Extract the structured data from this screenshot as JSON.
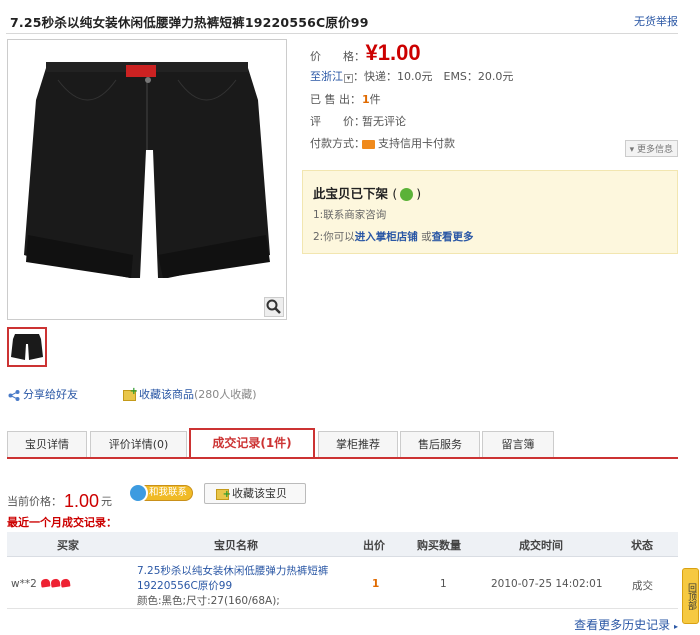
{
  "title": "7.25秒杀以纯女装休闲低腰弹力热裤短裤19220556C原价99",
  "report_link": "无货举报",
  "info": {
    "price_label": "价　　格：",
    "price": "¥1.00",
    "shipping_to": "至浙江",
    "shipping_fees": "：快递：10.0元　EMS：20.0元",
    "sold_label": "已 售 出：",
    "sold_count": "1",
    "sold_unit": "件",
    "rating_label": "评　　价：",
    "rating_value": "暂无评论",
    "payment_label": "付款方式：",
    "payment_value": "支持信用卡付款",
    "more_info": "更多信息"
  },
  "off_shelf": {
    "heading": "此宝贝已下架",
    "line1": "1:联系商家咨询",
    "line2_prefix": "2:你可以",
    "line2_link1": "进入掌柜店铺",
    "line2_mid": "或",
    "line2_link2": "查看更多"
  },
  "share_label": "分享给好友",
  "favorite": {
    "label": "收藏该商品",
    "count": "(280人收藏)"
  },
  "tabs": [
    {
      "label": "宝贝详情"
    },
    {
      "label": "评价详情(0)"
    },
    {
      "label": "成交记录(1件)"
    },
    {
      "label": "掌柜推荐"
    },
    {
      "label": "售后服务"
    },
    {
      "label": "留言簿"
    }
  ],
  "current_price": {
    "label": "当前价格：",
    "value": "1.00",
    "unit": "元"
  },
  "contact_button": "和我联系",
  "favorite_item_button": "收藏该宝贝",
  "recent_records_label": "最近一个月成交记录：",
  "table": {
    "headers": [
      "买家",
      "宝贝名称",
      "出价",
      "购买数量",
      "成交时间",
      "状态"
    ],
    "rows": [
      {
        "buyer": "w**2",
        "item_name_line1": "7.25秒杀以纯女装休闲低腰弹力热裤短裤",
        "item_name_line2": "19220556C原价99",
        "spec": "颜色:黑色;尺寸:27(160/68A);",
        "bid": "1",
        "quantity": "1",
        "time": "2010-07-25 14:02:01",
        "status": "成交"
      }
    ]
  },
  "back_to_top": "回顶部",
  "history_link": "查看更多历史记录"
}
